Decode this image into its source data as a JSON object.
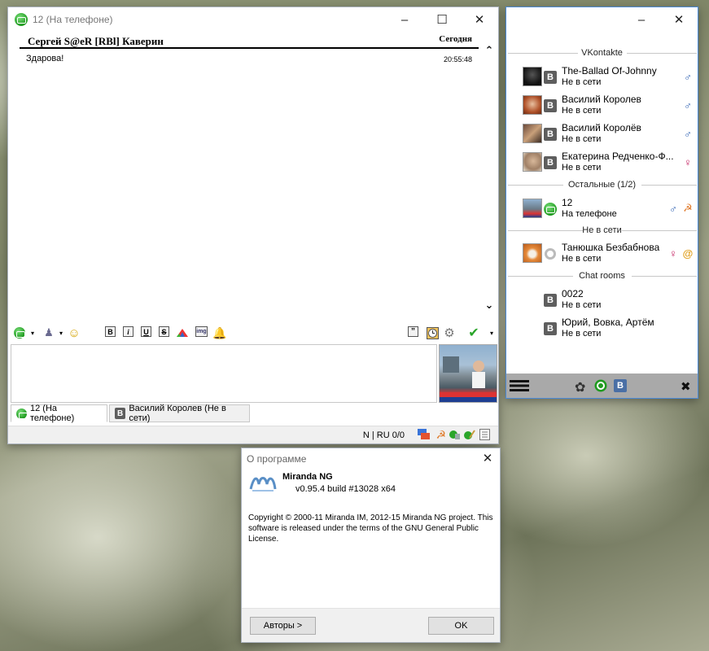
{
  "chat_window": {
    "title": "12 (На телефоне)",
    "log": {
      "header_name": "Сергей S@eR [RBl]  Каверин",
      "header_date": "Сегодня",
      "messages": [
        {
          "text": "Здарова!",
          "time": "20:55:48"
        }
      ]
    },
    "toolbar": {
      "bold": "B",
      "italic": "i",
      "underline": "U",
      "strike": "S",
      "img": "img"
    },
    "tabs": [
      {
        "label": "12 (На телефоне)",
        "active": true
      },
      {
        "label": "Василий Королев (Не в сети)",
        "active": false
      }
    ],
    "status_text": "N | RU 0/0"
  },
  "contact_list": {
    "groups": [
      {
        "title": "VKontakte",
        "contacts": [
          {
            "name": "The-Ballad Of-Johnny",
            "status": "Не в сети",
            "gender": "male"
          },
          {
            "name": "Василий Королев",
            "status": "Не в сети",
            "gender": "male"
          },
          {
            "name": "Василий Королёв",
            "status": "Не в сети",
            "gender": "male"
          },
          {
            "name": "Екатерина Редченко-Ф...",
            "status": "Не в сети",
            "gender": "female"
          }
        ]
      },
      {
        "title": "Остальные  (1/2)",
        "contacts": [
          {
            "name": "12",
            "status": "На телефоне",
            "gender": "male"
          }
        ]
      },
      {
        "title": "Не в сети",
        "contacts": [
          {
            "name": "Танюшка Безбабнова",
            "status": "Не в сети",
            "gender": "female"
          }
        ]
      },
      {
        "title": "Chat rooms",
        "contacts": [
          {
            "name": "0022",
            "status": "Не в сети"
          },
          {
            "name": "Юрий, Вовка, Артём",
            "status": "Не в сети"
          }
        ]
      }
    ],
    "vk_badge": "B"
  },
  "about_dialog": {
    "title": "О программе",
    "app_name": "Miranda NG",
    "version": "v0.95.4 build #13028 x64",
    "copyright": "Copyright © 2000-11 Miranda IM, 2012-15 Miranda NG project. This software is released under the terms of the GNU General Public License.",
    "authors_button": "Авторы >",
    "ok_button": "OK"
  },
  "colors": {
    "male": "#2a5db0",
    "female": "#c2185b",
    "vk_badge_bg": "#5e5e5e",
    "online_green": "#1f9a1f",
    "clist_border": "#4a89d6"
  }
}
